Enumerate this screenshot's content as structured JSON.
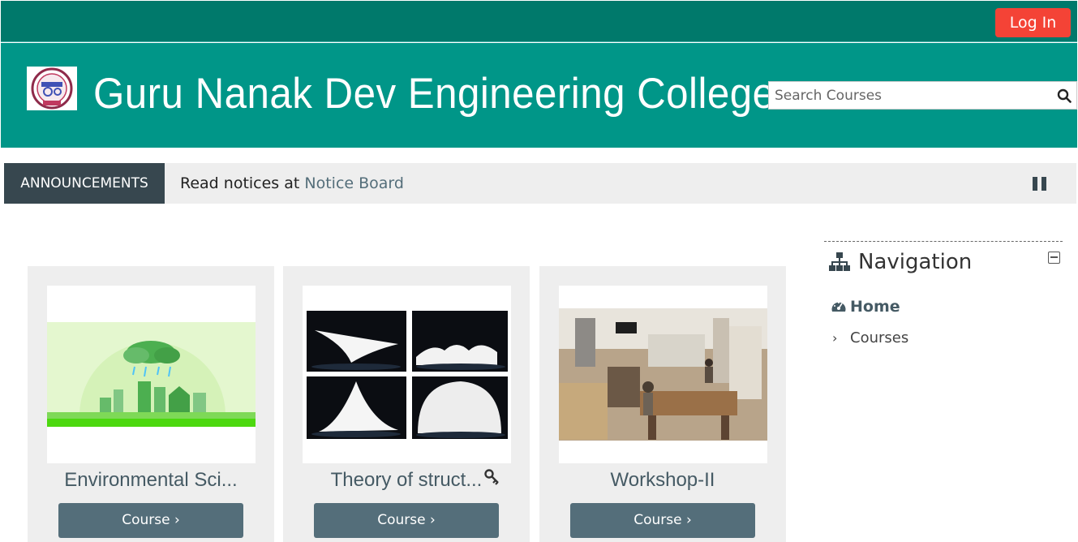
{
  "topbar": {
    "login_label": "Log In"
  },
  "header": {
    "site_title": "Guru Nanak Dev Engineering College",
    "search_placeholder": "Search Courses"
  },
  "announcements": {
    "label": "ANNOUNCEMENTS",
    "text": "Read notices at ",
    "link_text": "Notice Board"
  },
  "courses": [
    {
      "name": "Environmental Sci...",
      "button": "Course ›",
      "image": "environment-illustration"
    },
    {
      "name": "Theory of struct...",
      "button": "Course ›",
      "image": "tensile-structures",
      "key_icon": "key-icon"
    },
    {
      "name": "Workshop-II",
      "button": "Course ›",
      "image": "workshop-photo"
    }
  ],
  "navigation": {
    "title": "Navigation",
    "home": "Home",
    "courses": "Courses"
  },
  "colors": {
    "topbar": "#00796b",
    "header": "#009688",
    "login": "#f44336",
    "announce_label": "#37474f",
    "course_button": "#546e7a"
  }
}
